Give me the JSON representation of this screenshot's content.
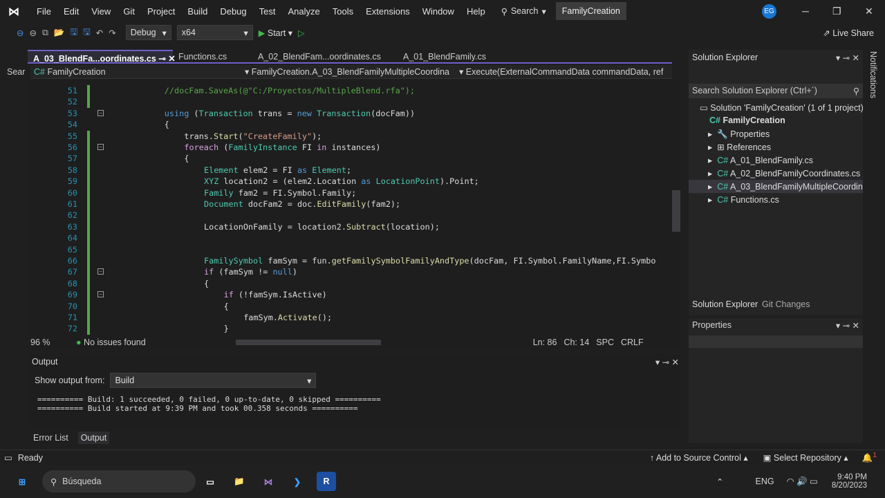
{
  "menu": {
    "items": [
      "File",
      "Edit",
      "View",
      "Git",
      "Project",
      "Build",
      "Debug",
      "Test",
      "Analyze",
      "Tools",
      "Extensions",
      "Window",
      "Help"
    ],
    "search": "Search",
    "title": "FamilyCreation",
    "avatar": "EG"
  },
  "toolbar": {
    "config": "Debug",
    "platform": "x64",
    "start": "Start",
    "live_share": "Live Share"
  },
  "tabs": [
    {
      "label": "A_03_BlendFa...oordinates.cs",
      "active": true
    },
    {
      "label": "Functions.cs"
    },
    {
      "label": "A_02_BlendFam...oordinates.cs"
    },
    {
      "label": "A_01_BlendFamily.cs"
    }
  ],
  "side_tab": "Sear",
  "navbar": {
    "project": "FamilyCreation",
    "class": "FamilyCreation.A_03_BlendFamilyMultipleCoordina",
    "method": "Execute(ExternalCommandData commandData, ref"
  },
  "code": [
    {
      "n": "51",
      "i": 12,
      "t": [
        [
          "//docFam.SaveAs(@\"C:/Proyectos/MultipleBlend.rfa\");",
          "cm"
        ]
      ]
    },
    {
      "n": "52",
      "i": 0,
      "t": []
    },
    {
      "n": "53",
      "i": 12,
      "t": [
        [
          "using",
          "kw"
        ],
        [
          " (",
          "pl"
        ],
        [
          "Transaction",
          "ty"
        ],
        [
          " trans = ",
          "pl"
        ],
        [
          "new",
          "kw"
        ],
        [
          " ",
          "pl"
        ],
        [
          "Transaction",
          "ty"
        ],
        [
          "(docFam))",
          "pl"
        ]
      ]
    },
    {
      "n": "54",
      "i": 12,
      "t": [
        [
          "{",
          "pl"
        ]
      ]
    },
    {
      "n": "55",
      "i": 16,
      "t": [
        [
          "trans.",
          "pl"
        ],
        [
          "Start",
          "me"
        ],
        [
          "(",
          "pl"
        ],
        [
          "\"CreateFamily\"",
          "st"
        ],
        [
          ");",
          "pl"
        ]
      ]
    },
    {
      "n": "56",
      "i": 16,
      "t": [
        [
          "foreach",
          "ctl"
        ],
        [
          " (",
          "pl"
        ],
        [
          "FamilyInstance",
          "ty"
        ],
        [
          " FI ",
          "pl"
        ],
        [
          "in",
          "ctl"
        ],
        [
          " instances)",
          "pl"
        ]
      ]
    },
    {
      "n": "57",
      "i": 16,
      "t": [
        [
          "{",
          "pl"
        ]
      ]
    },
    {
      "n": "58",
      "i": 20,
      "t": [
        [
          "Element",
          "ty"
        ],
        [
          " elem2 = FI ",
          "pl"
        ],
        [
          "as",
          "kw"
        ],
        [
          " ",
          "pl"
        ],
        [
          "Element",
          "ty"
        ],
        [
          ";",
          "pl"
        ]
      ]
    },
    {
      "n": "59",
      "i": 20,
      "t": [
        [
          "XYZ",
          "ty"
        ],
        [
          " location2 = (elem2.Location ",
          "pl"
        ],
        [
          "as",
          "kw"
        ],
        [
          " ",
          "pl"
        ],
        [
          "LocationPoint",
          "ty"
        ],
        [
          ").Point;",
          "pl"
        ]
      ]
    },
    {
      "n": "60",
      "i": 20,
      "t": [
        [
          "Family",
          "ty"
        ],
        [
          " fam2 = FI.Symbol.Family;",
          "pl"
        ]
      ]
    },
    {
      "n": "61",
      "i": 20,
      "t": [
        [
          "Document",
          "ty"
        ],
        [
          " docFam2 = doc.",
          "pl"
        ],
        [
          "EditFamily",
          "me"
        ],
        [
          "(fam2);",
          "pl"
        ]
      ]
    },
    {
      "n": "62",
      "i": 0,
      "t": []
    },
    {
      "n": "63",
      "i": 20,
      "t": [
        [
          "LocationOnFamily = location2.",
          "pl"
        ],
        [
          "Subtract",
          "me"
        ],
        [
          "(location);",
          "pl"
        ]
      ]
    },
    {
      "n": "64",
      "i": 0,
      "t": []
    },
    {
      "n": "65",
      "i": 0,
      "t": []
    },
    {
      "n": "66",
      "i": 20,
      "t": [
        [
          "FamilySymbol",
          "ty"
        ],
        [
          " famSym = fun.",
          "pl"
        ],
        [
          "getFamilySymbolFamilyAndType",
          "me"
        ],
        [
          "(docFam, FI.Symbol.FamilyName,FI.Symbo",
          "pl"
        ]
      ]
    },
    {
      "n": "67",
      "i": 20,
      "t": [
        [
          "if",
          "ctl"
        ],
        [
          " (famSym != ",
          "pl"
        ],
        [
          "null",
          "kw"
        ],
        [
          ")",
          "pl"
        ]
      ]
    },
    {
      "n": "68",
      "i": 20,
      "t": [
        [
          "{",
          "pl"
        ]
      ]
    },
    {
      "n": "69",
      "i": 24,
      "t": [
        [
          "if",
          "ctl"
        ],
        [
          " (!famSym.IsActive)",
          "pl"
        ]
      ]
    },
    {
      "n": "70",
      "i": 24,
      "t": [
        [
          "{",
          "pl"
        ]
      ]
    },
    {
      "n": "71",
      "i": 28,
      "t": [
        [
          "famSym.",
          "pl"
        ],
        [
          "Activate",
          "me"
        ],
        [
          "();",
          "pl"
        ]
      ]
    },
    {
      "n": "72",
      "i": 24,
      "t": [
        [
          "}",
          "pl"
        ]
      ]
    }
  ],
  "editor_status": {
    "zoom": "96 %",
    "issues": "No issues found",
    "position": "Ln: 86",
    "column": "Ch: 14",
    "spacing": "SPC",
    "line_ending": "CRLF"
  },
  "solution_explorer": {
    "title": "Solution Explorer",
    "search_placeholder": "Search Solution Explorer (Ctrl+´)",
    "solution": "Solution 'FamilyCreation' (1 of 1 project)",
    "project": "FamilyCreation",
    "items": [
      "Properties",
      "References",
      "A_01_BlendFamily.cs",
      "A_02_BlendFamilyCoordinates.cs",
      "A_03_BlendFamilyMultipleCoordin",
      "Functions.cs"
    ],
    "tabs": [
      "Solution Explorer",
      "Git Changes"
    ]
  },
  "properties": {
    "title": "Properties"
  },
  "output": {
    "title": "Output",
    "show_from_label": "Show output from:",
    "source": "Build",
    "lines": [
      "========== Build: 1 succeeded, 0 failed, 0 up-to-date, 0 skipped ==========",
      "========== Build started at 9:39 PM and took 00.358 seconds =========="
    ],
    "tabs": [
      "Error List",
      "Output"
    ]
  },
  "statusbar": {
    "ready": "Ready",
    "source_control": "Add to Source Control",
    "repo": "Select Repository",
    "notifications": "1"
  },
  "notifications_tab": "Notifications",
  "taskbar": {
    "search": "Búsqueda",
    "lang": "ENG",
    "time": "9:40 PM",
    "date": "8/20/2023"
  },
  "colors": {
    "accent": "#6e60c8",
    "status_green": "#57a64a"
  }
}
